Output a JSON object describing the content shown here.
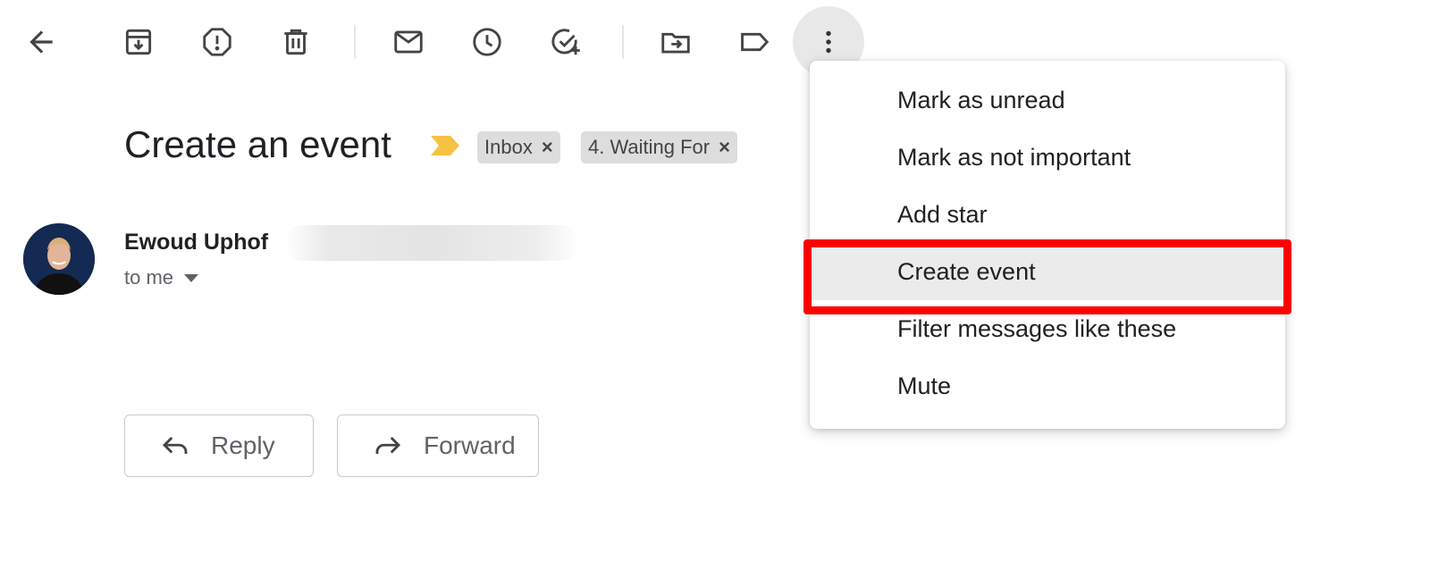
{
  "toolbar": {
    "back": "arrow-back-icon",
    "buttons": [
      "archive-icon",
      "report-spam-icon",
      "delete-icon",
      "mark-unread-icon",
      "snooze-icon",
      "add-to-tasks-icon",
      "move-to-icon",
      "labels-icon",
      "more-icon"
    ]
  },
  "message": {
    "subject": "Create an event",
    "labels": [
      "Inbox",
      "4. Waiting For"
    ],
    "label_remove": "×",
    "sender_name": "Ewoud Uphof",
    "recipient": "to me"
  },
  "actions": {
    "reply": "Reply",
    "forward": "Forward"
  },
  "more_menu": {
    "items": [
      "Mark as unread",
      "Mark as not important",
      "Add star",
      "Create event",
      "Filter messages like these",
      "Mute"
    ],
    "highlighted": "Create event"
  },
  "colors": {
    "importance_marker": "#f6c244",
    "highlight": "#ff0000"
  }
}
